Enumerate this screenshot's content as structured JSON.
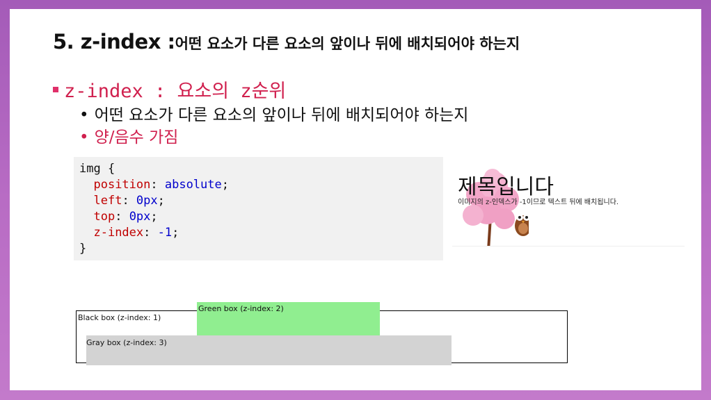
{
  "title": {
    "main": "5. z-index :",
    "desc": "어떤 요소가 다른 요소의 앞이나 뒤에 배치되어야 하는지"
  },
  "bullet": {
    "text": "z-index : 요소의 z순위"
  },
  "subitems": [
    "어떤 요소가 다른 요소의 앞이나 뒤에 배치되어야 하는지",
    "양/음수 가짐"
  ],
  "code": {
    "selector": "img {",
    "lines": [
      {
        "prop": "position",
        "val": "absolute"
      },
      {
        "prop": "left",
        "val": "0px"
      },
      {
        "prop": "top",
        "val": "0px"
      },
      {
        "prop": "z-index",
        "val": "-1"
      }
    ],
    "close": "}"
  },
  "demo": {
    "heading": "제목입니다",
    "paragraph": "이미지의 z-인덱스가 -1이므로 텍스트 뒤에 배치됩니다."
  },
  "boxes": {
    "black": "Black box (z-index: 1)",
    "green": "Green box (z-index: 2)",
    "gray": "Gray box (z-index: 3)"
  },
  "colors": {
    "accent": "#d0204e",
    "green_box": "#90ee90",
    "gray_box": "#d3d3d3",
    "code_bg": "#f1f1f1",
    "tree_pink": "#f2a6c8",
    "trunk": "#7a3b1c"
  }
}
